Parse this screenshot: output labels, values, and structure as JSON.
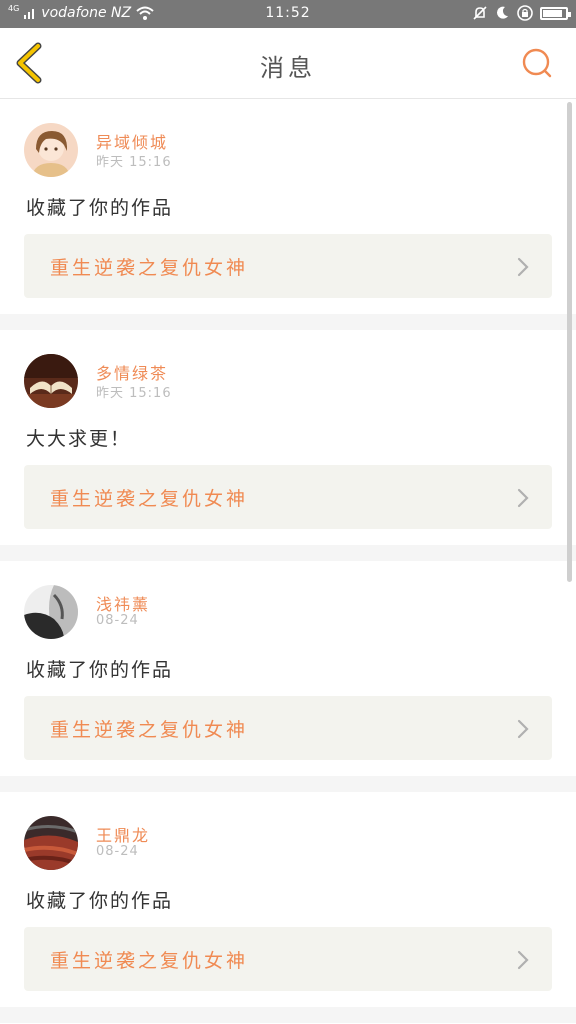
{
  "status_bar": {
    "network": "4G",
    "carrier": "vodafone NZ",
    "time": "11:52",
    "battery_level": 0.85
  },
  "header": {
    "title": "消息",
    "back_icon": "chevron-left-icon",
    "search_icon": "search-icon",
    "accent_back": "#f5c400",
    "accent_search": "#f08a52"
  },
  "notifications": [
    {
      "user": "异域倾城",
      "time": "昨天 15:16",
      "message": "收藏了你的作品",
      "work_title": "重生逆袭之复仇女神"
    },
    {
      "user": "多情绿茶",
      "time": "昨天 15:16",
      "message": "大大求更！",
      "work_title": "重生逆袭之复仇女神"
    },
    {
      "user": "浅祎薰",
      "time": "08-24",
      "message": "收藏了你的作品",
      "work_title": "重生逆袭之复仇女神"
    },
    {
      "user": "王鼎龙",
      "time": "08-24",
      "message": "收藏了你的作品",
      "work_title": "重生逆袭之复仇女神"
    }
  ],
  "colors": {
    "username": "#ef8b56",
    "work_title": "#f08a52",
    "card_link_bg": "#f3f3ee",
    "separator": "#f5f5f5"
  }
}
